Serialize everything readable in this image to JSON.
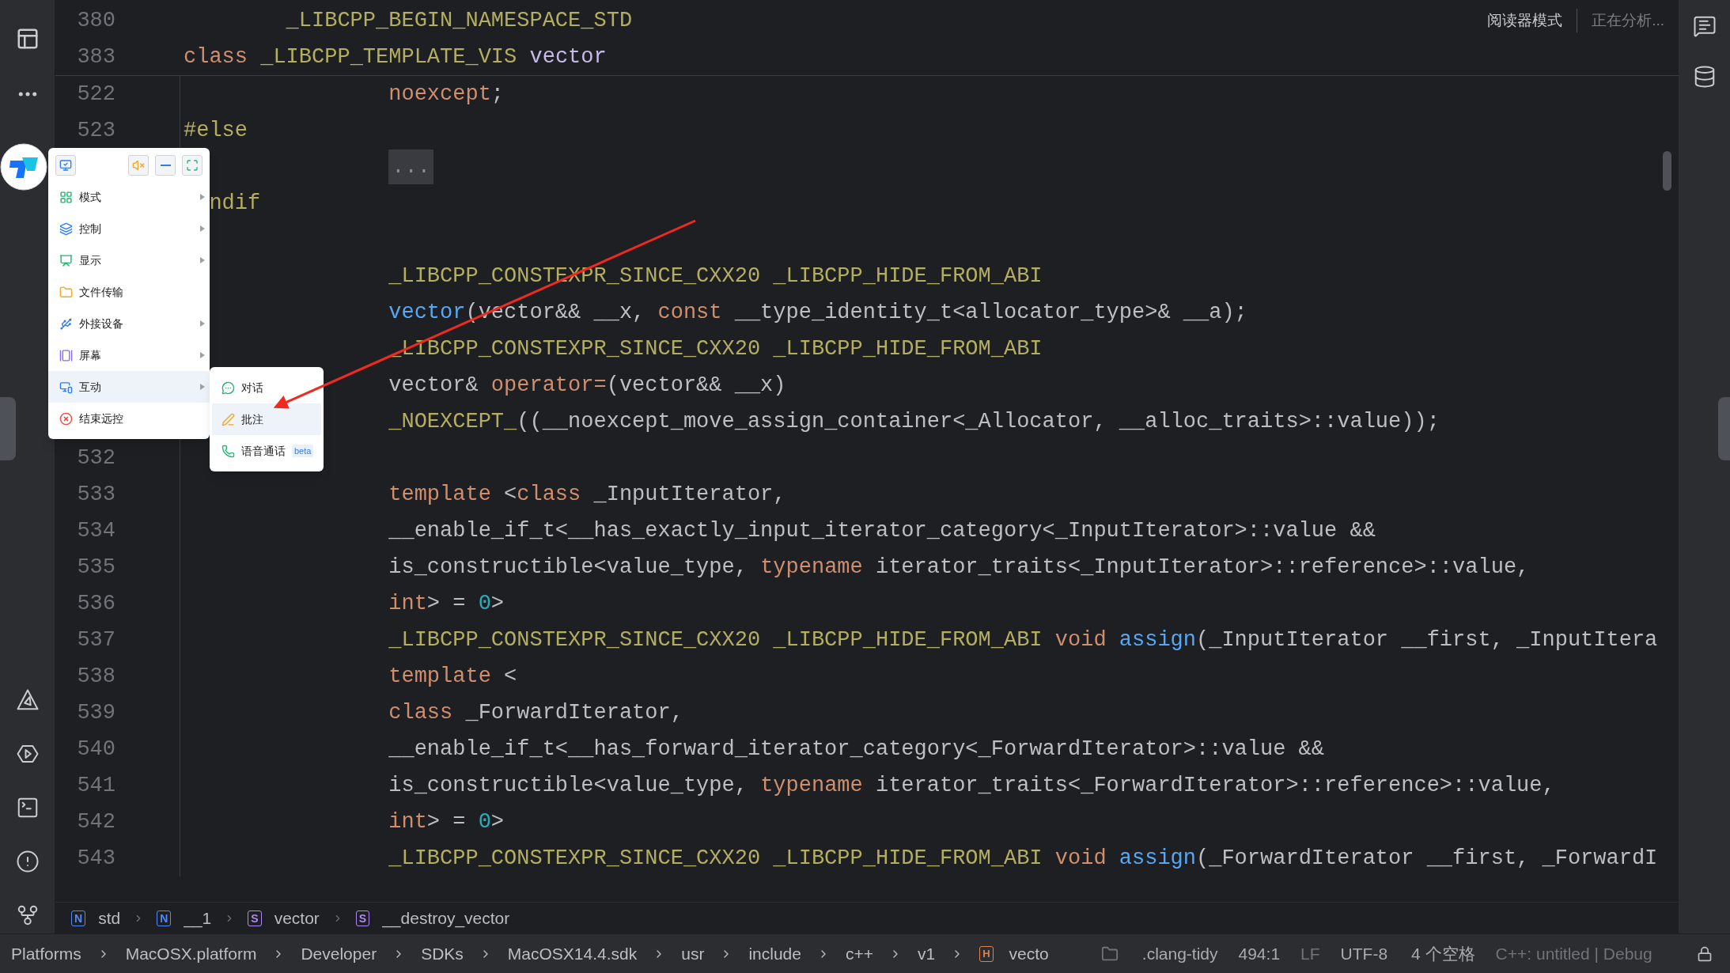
{
  "editor": {
    "sticky_lines": [
      {
        "number": "380",
        "kind": "nested",
        "tokens": [
          {
            "text": "_LIBCPP_BEGIN_NAMESPACE_STD",
            "kind": "macro"
          }
        ]
      },
      {
        "number": "383",
        "kind": "top",
        "tokens": [
          {
            "text": "class",
            "kind": "keyword"
          },
          {
            "text": " _LIBCPP_TEMPLATE_VIS ",
            "kind": "macro"
          },
          {
            "text": "vector",
            "kind": "class_name"
          }
        ]
      }
    ],
    "reader_mode": "阅读器模式",
    "analysis_status": "正在分析...",
    "lines": [
      {
        "number": "522",
        "kind": "body",
        "tokens": [
          {
            "text": "noexcept",
            "kind": "keyword"
          },
          {
            "text": ";",
            "kind": "plain"
          }
        ]
      },
      {
        "number": "523",
        "kind": "top",
        "tokens": [
          {
            "text": "#else",
            "kind": "macro"
          }
        ]
      },
      {
        "kind": "body",
        "tokens": [
          {
            "text": "...",
            "kind": "fold"
          }
        ]
      },
      {
        "kind": "covered",
        "tokens": [
          {
            "text": "ndif",
            "kind": "macro"
          }
        ]
      },
      {
        "kind": "blank"
      },
      {
        "kind": "body",
        "tokens": [
          {
            "text": "_LIBCPP_CONSTEXPR_SINCE_CXX20 _LIBCPP_HIDE_FROM_ABI",
            "kind": "macro"
          }
        ]
      },
      {
        "kind": "body",
        "tokens": [
          {
            "text": "vector",
            "kind": "function"
          },
          {
            "text": "(vector&& __x, ",
            "kind": "plain"
          },
          {
            "text": "const",
            "kind": "keyword"
          },
          {
            "text": " __type_identity_t<allocator_type>& __a);",
            "kind": "plain"
          }
        ]
      },
      {
        "kind": "body",
        "tokens": [
          {
            "text": "_LIBCPP_CONSTEXPR_SINCE_CXX20 _LIBCPP_HIDE_FROM_ABI",
            "kind": "macro"
          }
        ]
      },
      {
        "kind": "body",
        "tokens": [
          {
            "text": "vector& ",
            "kind": "plain"
          },
          {
            "text": "operator=",
            "kind": "keyword"
          },
          {
            "text": "(vector&& __x)",
            "kind": "plain"
          }
        ]
      },
      {
        "kind": "body",
        "tokens": [
          {
            "text": "_NOEXCEPT_",
            "kind": "macro"
          },
          {
            "text": "((__noexcept_move_assign_container<_Allocator, __alloc_traits>::value));",
            "kind": "plain"
          }
        ]
      },
      {
        "number": "532",
        "kind": "blank"
      },
      {
        "number": "533",
        "kind": "body",
        "tokens": [
          {
            "text": "template",
            "kind": "keyword"
          },
          {
            "text": " <",
            "kind": "plain"
          },
          {
            "text": "class",
            "kind": "keyword"
          },
          {
            "text": " _InputIterator,",
            "kind": "plain"
          }
        ]
      },
      {
        "number": "534",
        "kind": "body",
        "tokens": [
          {
            "text": "__enable_if_t<__has_exactly_input_iterator_category<_InputIterator>::value &&",
            "kind": "plain"
          }
        ]
      },
      {
        "number": "535",
        "kind": "body",
        "tokens": [
          {
            "text": "is_constructible<value_type, ",
            "kind": "plain"
          },
          {
            "text": "typename",
            "kind": "keyword"
          },
          {
            "text": " iterator_traits<_InputIterator>::reference>::value,",
            "kind": "plain"
          }
        ]
      },
      {
        "number": "536",
        "kind": "body",
        "tokens": [
          {
            "text": "int",
            "kind": "keyword"
          },
          {
            "text": "> = ",
            "kind": "plain"
          },
          {
            "text": "0",
            "kind": "number"
          },
          {
            "text": ">",
            "kind": "plain"
          }
        ]
      },
      {
        "number": "537",
        "kind": "body",
        "tokens": [
          {
            "text": "_LIBCPP_CONSTEXPR_SINCE_CXX20 _LIBCPP_HIDE_FROM_ABI ",
            "kind": "macro"
          },
          {
            "text": "void ",
            "kind": "keyword"
          },
          {
            "text": "assign",
            "kind": "function"
          },
          {
            "text": "(_InputIterator __first, _InputItera",
            "kind": "plain"
          }
        ]
      },
      {
        "number": "538",
        "kind": "body",
        "tokens": [
          {
            "text": "template",
            "kind": "keyword"
          },
          {
            "text": " <",
            "kind": "plain"
          }
        ]
      },
      {
        "number": "539",
        "kind": "body",
        "tokens": [
          {
            "text": "class",
            "kind": "keyword"
          },
          {
            "text": " _ForwardIterator,",
            "kind": "plain"
          }
        ]
      },
      {
        "number": "540",
        "kind": "body",
        "tokens": [
          {
            "text": "__enable_if_t<__has_forward_iterator_category<_ForwardIterator>::value &&",
            "kind": "plain"
          }
        ]
      },
      {
        "number": "541",
        "kind": "body",
        "tokens": [
          {
            "text": "is_constructible<value_type, ",
            "kind": "plain"
          },
          {
            "text": "typename",
            "kind": "keyword"
          },
          {
            "text": " iterator_traits<_ForwardIterator>::reference>::value,",
            "kind": "plain"
          }
        ]
      },
      {
        "number": "542",
        "kind": "body",
        "tokens": [
          {
            "text": "int",
            "kind": "keyword"
          },
          {
            "text": "> = ",
            "kind": "plain"
          },
          {
            "text": "0",
            "kind": "number"
          },
          {
            "text": ">",
            "kind": "plain"
          }
        ]
      },
      {
        "number": "543",
        "kind": "body",
        "tokens": [
          {
            "text": "_LIBCPP_CONSTEXPR_SINCE_CXX20 _LIBCPP_HIDE_FROM_ABI ",
            "kind": "macro"
          },
          {
            "text": "void ",
            "kind": "keyword"
          },
          {
            "text": "assign",
            "kind": "function"
          },
          {
            "text": "(_ForwardIterator __first, _ForwardI",
            "kind": "plain"
          }
        ]
      }
    ]
  },
  "breadcrumb": [
    {
      "badge": "N",
      "kind": "namespace",
      "label": "std"
    },
    {
      "badge": "N",
      "kind": "namespace",
      "label": "__1"
    },
    {
      "badge": "S",
      "kind": "struct",
      "label": "vector"
    },
    {
      "badge": "S",
      "kind": "struct",
      "label": "__destroy_vector"
    }
  ],
  "status_bar": {
    "path": [
      {
        "label": "Platforms"
      },
      {
        "label": "MacOSX.platform"
      },
      {
        "label": "Developer"
      },
      {
        "label": "SDKs"
      },
      {
        "label": "MacOSX14.4.sdk"
      },
      {
        "label": "usr"
      },
      {
        "label": "include"
      },
      {
        "label": "c++"
      },
      {
        "label": "v1"
      },
      {
        "label": "vecto",
        "badge": "H"
      }
    ],
    "inspections": ".clang-tidy",
    "position": "494:1",
    "line_ending": "LF",
    "encoding": "UTF-8",
    "indent": "4 个空格",
    "context": "C++: untitled | Debug"
  },
  "remote_menu": {
    "items": [
      {
        "label": "模式",
        "submenu": true,
        "selected": false
      },
      {
        "label": "控制",
        "submenu": true,
        "selected": false
      },
      {
        "label": "显示",
        "submenu": true,
        "selected": false
      },
      {
        "label": "文件传输",
        "submenu": false,
        "selected": false
      },
      {
        "label": "外接设备",
        "submenu": true,
        "selected": false
      },
      {
        "label": "屏幕",
        "submenu": true,
        "selected": false
      },
      {
        "label": "互动",
        "submenu": true,
        "selected": true
      },
      {
        "label": "结束远控",
        "submenu": false,
        "selected": false
      }
    ],
    "submenu": [
      {
        "label": "对话",
        "selected": false
      },
      {
        "label": "批注",
        "selected": true
      },
      {
        "label": "语音通话",
        "selected": false,
        "badge": "beta"
      }
    ]
  }
}
